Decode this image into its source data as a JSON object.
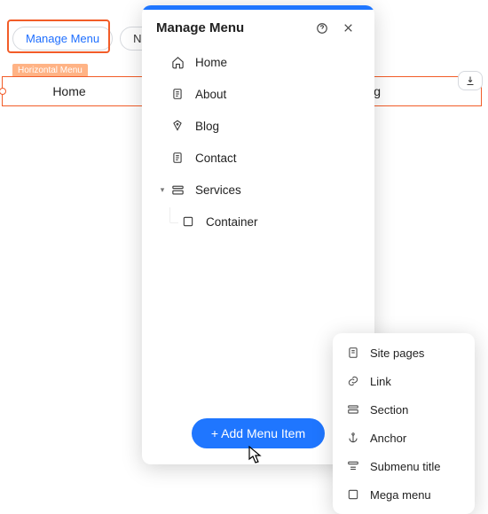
{
  "toolbar": {
    "manage_menu": "Manage Menu",
    "navigate_partial": "Na"
  },
  "canvas": {
    "tag": "Horizontal Menu",
    "menu_items": {
      "home": "Home",
      "blog": "Blog"
    }
  },
  "panel": {
    "title": "Manage Menu",
    "items": [
      {
        "icon": "home-icon",
        "label": "Home"
      },
      {
        "icon": "page-icon",
        "label": "About"
      },
      {
        "icon": "pen-icon",
        "label": "Blog"
      },
      {
        "icon": "page-icon",
        "label": "Contact"
      },
      {
        "icon": "section-icon",
        "label": "Services",
        "expandable": true
      },
      {
        "icon": "square-icon",
        "label": "Container",
        "child": true
      }
    ],
    "add_button": "+ Add Menu Item"
  },
  "popup": {
    "items": [
      {
        "icon": "page-icon",
        "label": "Site pages"
      },
      {
        "icon": "link-icon",
        "label": "Link"
      },
      {
        "icon": "section-icon",
        "label": "Section"
      },
      {
        "icon": "anchor-icon",
        "label": "Anchor"
      },
      {
        "icon": "submenu-icon",
        "label": "Submenu title"
      },
      {
        "icon": "square-icon",
        "label": "Mega menu"
      }
    ]
  }
}
